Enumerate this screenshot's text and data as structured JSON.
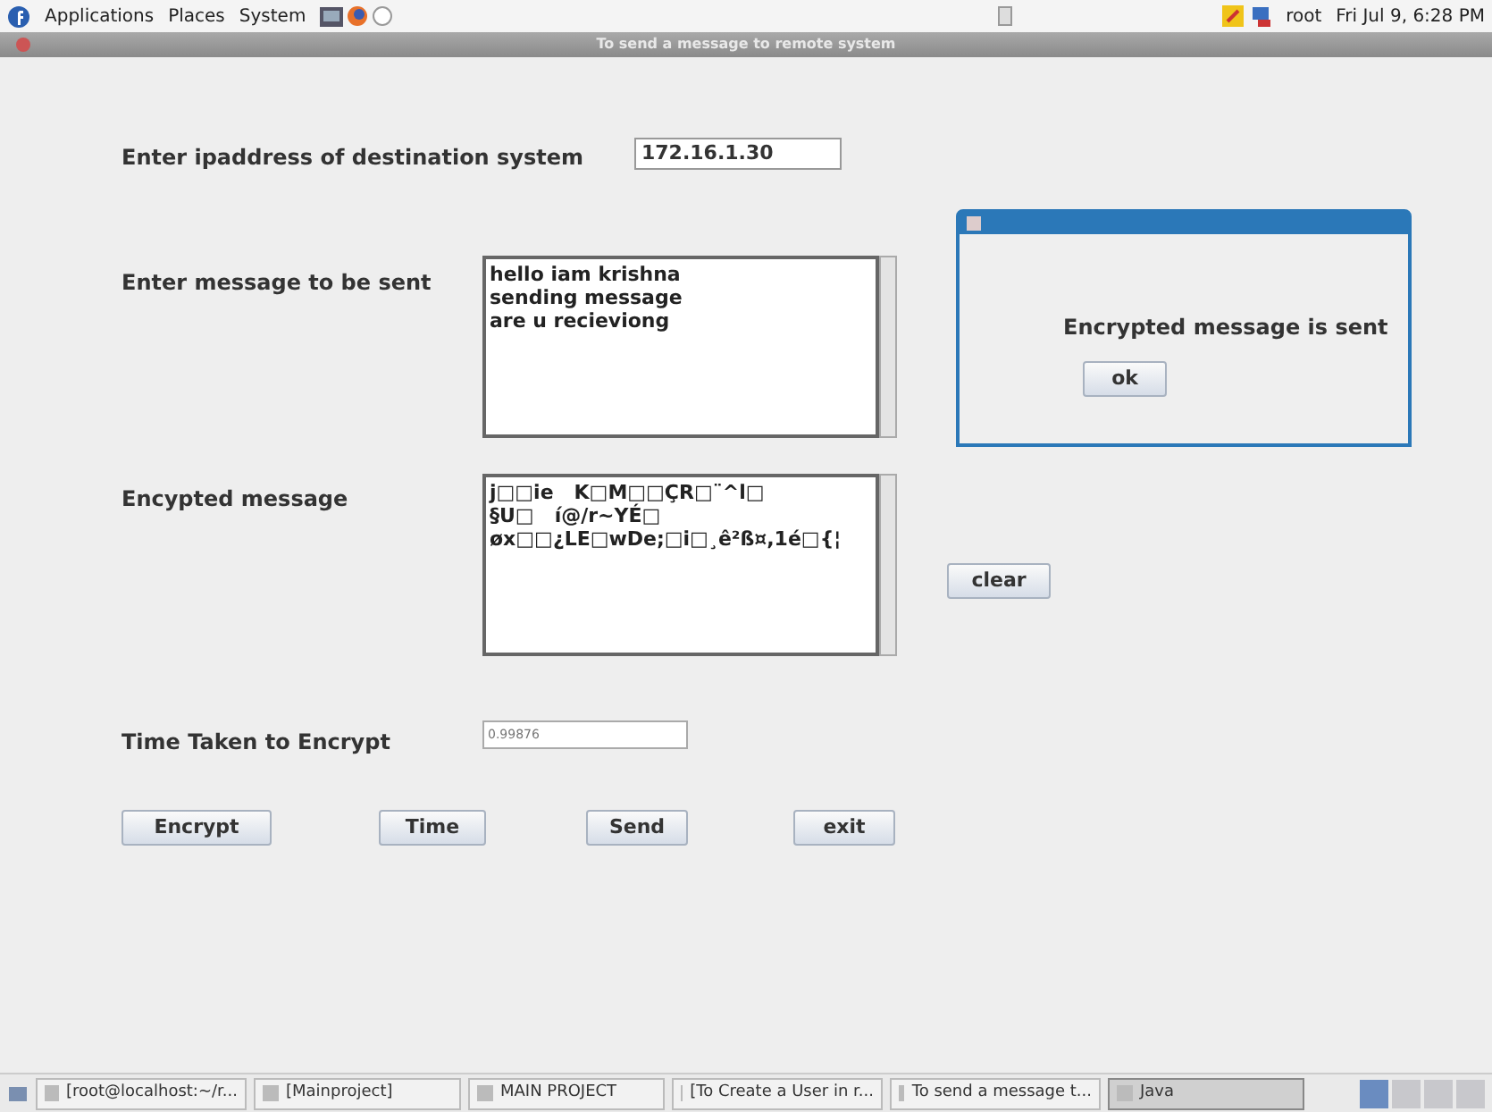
{
  "top_panel": {
    "menus": [
      "Applications",
      "Places",
      "System"
    ],
    "user": "root",
    "clock": "Fri Jul 9, 6:28 PM"
  },
  "window": {
    "title": "To send a message to remote system"
  },
  "form": {
    "ip_label": "Enter ipaddress of destination system",
    "ip_value": "172.16.1.30",
    "message_label": "Enter message to be sent",
    "message_lines": [
      "hello iam krishna",
      "sending message",
      "are u recieviong"
    ],
    "encrypted_label": "Encypted message",
    "encrypted_lines": [
      "j□□ie   K□M□□ÇR□¨^l□",
      "§U□   í@/r~YÉ□",
      "øx□□¿LE□wDe;□i□¸ê²ß¤,1é□{¦"
    ],
    "clear_button": "clear",
    "time_label": "Time Taken to Encrypt",
    "time_value": "0.99876",
    "buttons": [
      "Encrypt",
      "Time",
      "Send",
      "exit"
    ]
  },
  "dialog": {
    "message": "Encrypted message is sent",
    "button": "ok"
  },
  "taskbar": {
    "items": [
      {
        "label": "[root@localhost:~/r...",
        "selected": false
      },
      {
        "label": "[Mainproject]",
        "selected": false
      },
      {
        "label": "MAIN PROJECT",
        "selected": false
      },
      {
        "label": "[To Create a User in r...",
        "selected": false
      },
      {
        "label": "To send a message t...",
        "selected": false
      },
      {
        "label": "Java",
        "selected": true
      }
    ]
  }
}
